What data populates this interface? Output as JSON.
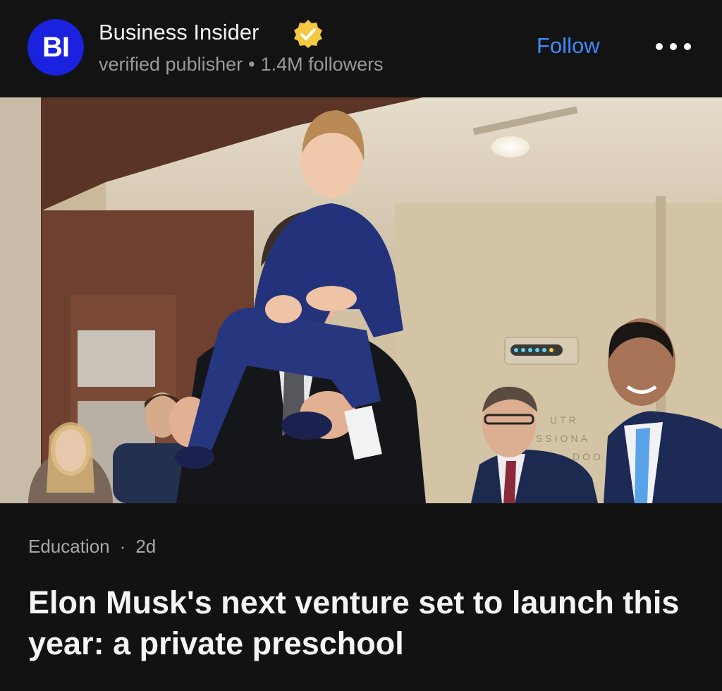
{
  "publisher": {
    "logo_text": "BI",
    "name": "Business Insider",
    "subtitle": "verified publisher",
    "followers": "1.4M followers",
    "follow_label": "Follow",
    "verified_icon": "verified-badge-icon",
    "logo_color": "#1a22e0",
    "badge_color": "#f5c842"
  },
  "header": {
    "more_icon": "more-dots-icon"
  },
  "photo": {
    "sign_text": "UTR\nSSIONA\nDOO"
  },
  "article": {
    "category": "Education",
    "age": "2d",
    "headline": "Elon Musk's next venture set to launch this year: a private preschool"
  },
  "colors": {
    "background": "#111111",
    "accent": "#3d8bff"
  }
}
